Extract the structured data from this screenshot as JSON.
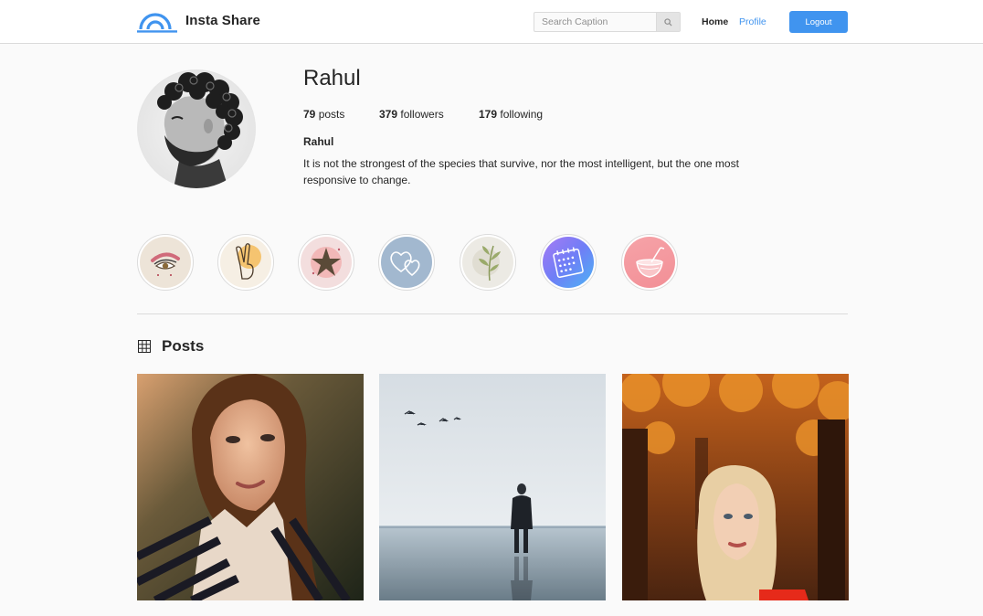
{
  "header": {
    "app_title": "Insta Share",
    "search_placeholder": "Search Caption",
    "nav_home": "Home",
    "nav_profile": "Profile",
    "logout_label": "Logout"
  },
  "profile": {
    "username": "Rahul",
    "stats": {
      "posts_count": "79",
      "posts_label": "posts",
      "followers_count": "379",
      "followers_label": "followers",
      "following_count": "179",
      "following_label": "following"
    },
    "display_name": "Rahul",
    "bio": "It is not the strongest of the species that survive, nor the most intelligent, but the one most responsive to change."
  },
  "stories": [
    {
      "icon": "eye-makeup-icon"
    },
    {
      "icon": "peace-hand-icon"
    },
    {
      "icon": "star-icon"
    },
    {
      "icon": "hearts-icon"
    },
    {
      "icon": "leaf-icon"
    },
    {
      "icon": "calendar-icon"
    },
    {
      "icon": "drink-icon"
    }
  ],
  "posts_section": {
    "title": "Posts"
  },
  "colors": {
    "accent": "#4094ef",
    "border": "#dbdbdb",
    "background": "#fafafa"
  }
}
